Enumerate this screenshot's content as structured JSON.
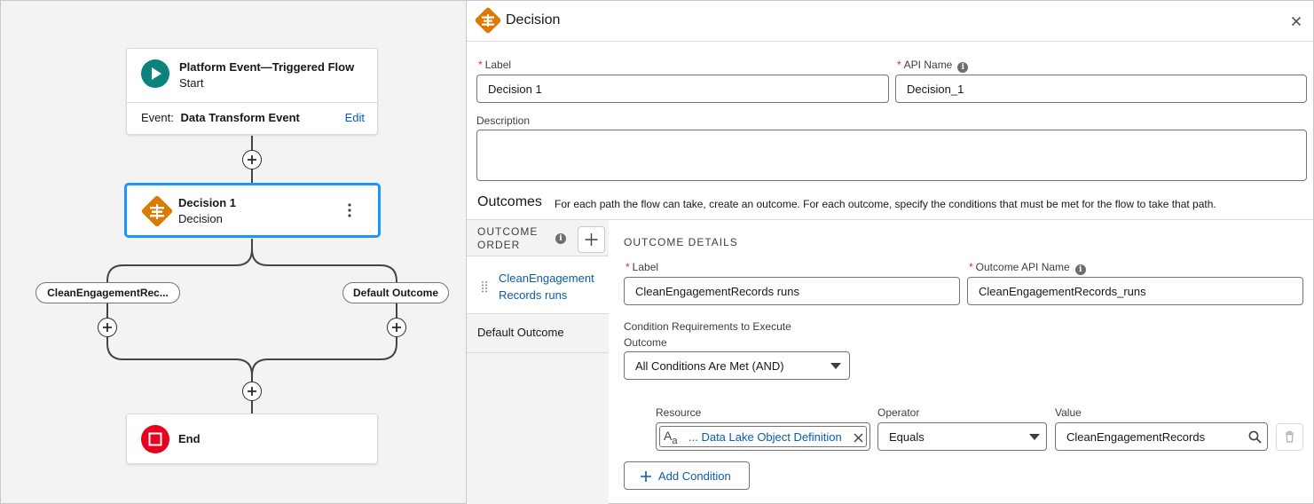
{
  "canvas": {
    "start": {
      "title": "Platform Event—Triggered Flow",
      "subtitle": "Start",
      "event_label": "Event:",
      "event_value": "Data Transform Event",
      "edit": "Edit"
    },
    "decision": {
      "title": "Decision 1",
      "subtitle": "Decision"
    },
    "branches": {
      "left": "CleanEngagementRec...",
      "right": "Default Outcome"
    },
    "end": {
      "title": "End"
    }
  },
  "panel": {
    "title": "Decision",
    "label": {
      "label": "Label",
      "value": "Decision 1"
    },
    "api_name": {
      "label": "API Name",
      "value": "Decision_1"
    },
    "description": {
      "label": "Description",
      "value": ""
    },
    "outcomes": {
      "heading": "Outcomes",
      "help": "For each path the flow can take, create an outcome. For each outcome, specify the conditions that must be met for the flow to take that path."
    },
    "order": {
      "heading_line1": "OUTCOME",
      "heading_line2": "ORDER",
      "items": [
        {
          "line1": "CleanEngagement",
          "line2": "Records runs",
          "selected": true
        },
        {
          "line1": "Default Outcome",
          "line2": "",
          "selected": false
        }
      ]
    },
    "details": {
      "heading": "OUTCOME DETAILS",
      "label": {
        "label": "Label",
        "value": "CleanEngagementRecords runs"
      },
      "api_name": {
        "label": "Outcome API Name",
        "value": "CleanEngagementRecords_runs"
      },
      "requirements": {
        "label_line1": "Condition Requirements to Execute",
        "label_line2": "Outcome",
        "value": "All Conditions Are Met (AND)"
      },
      "condition": {
        "resource_label": "Resource",
        "resource_value": "... Data Lake Object Definition",
        "operator_label": "Operator",
        "operator_value": "Equals",
        "value_label": "Value",
        "value_value": "CleanEngagementRecords"
      },
      "add_condition": "Add Condition"
    }
  },
  "colors": {
    "start": "#0b827c",
    "decision": "#dd7a01",
    "end": "#ea001e",
    "link": "#0b5cab",
    "selected_border": "#1b96ff"
  }
}
